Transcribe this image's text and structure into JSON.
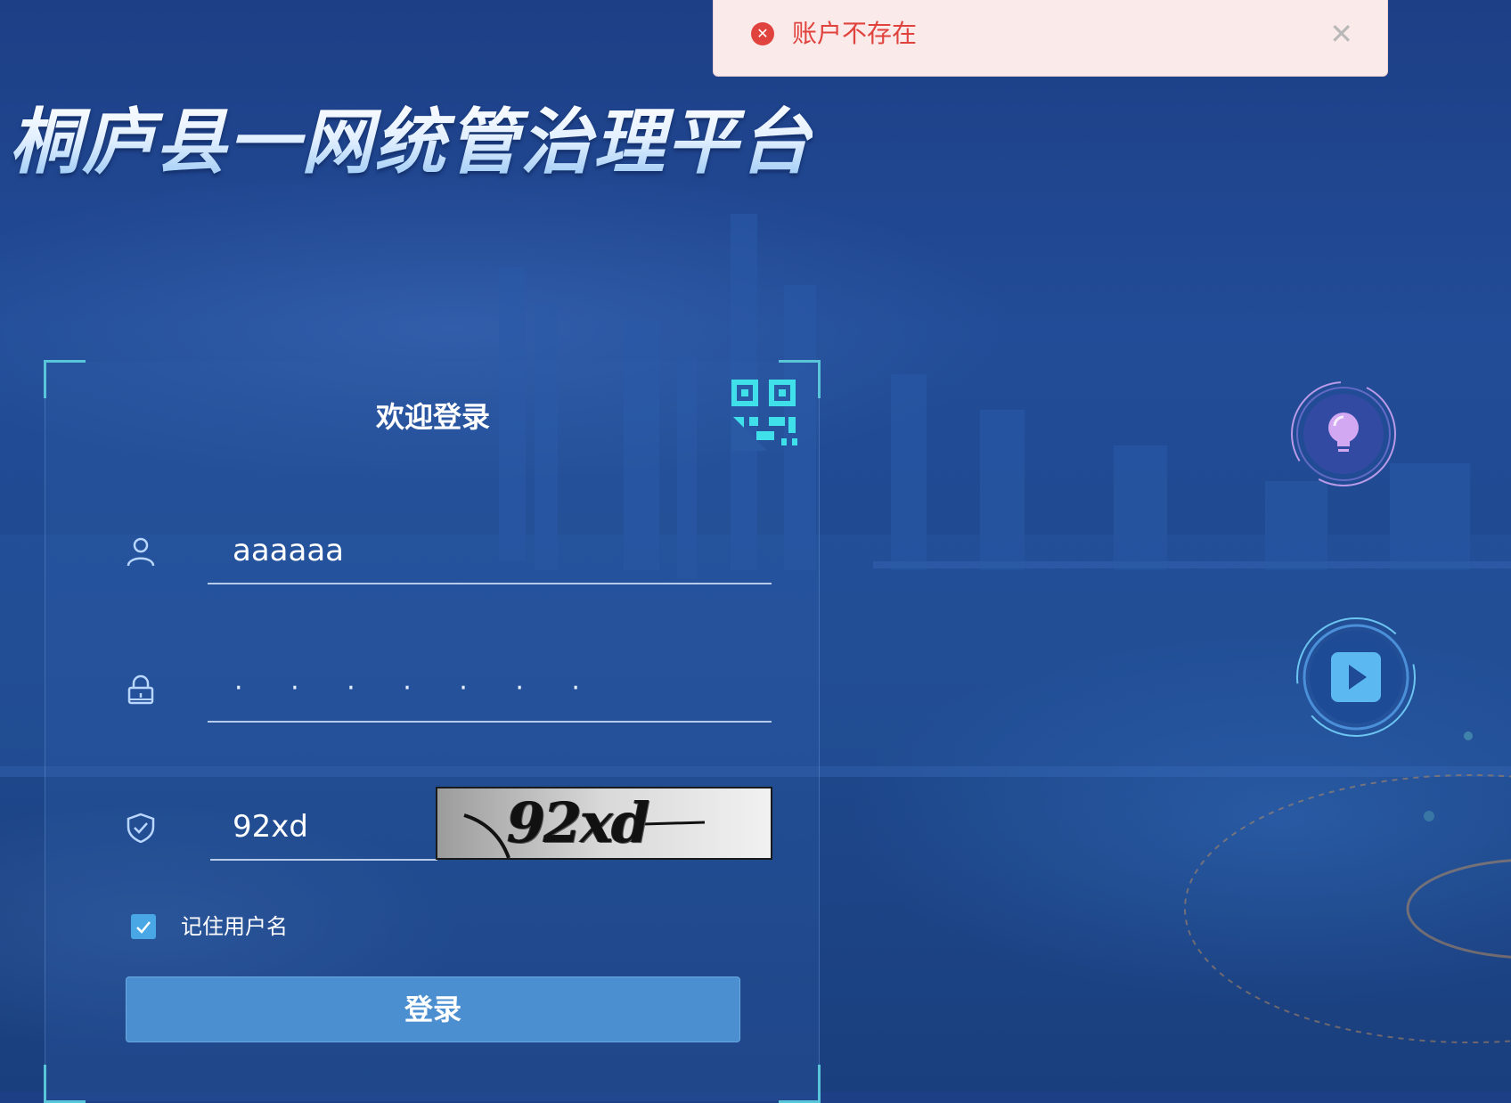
{
  "toast": {
    "type": "error",
    "message": "账户不存在",
    "icon": "error-circle-icon",
    "close_icon": "close-icon",
    "color": "#e0433e"
  },
  "header": {
    "title": "桐庐县一网统管治理平台"
  },
  "login": {
    "title": "欢迎登录",
    "qr_icon": "qr-code-icon",
    "username": {
      "icon": "user-icon",
      "value": "aaaaaa"
    },
    "password": {
      "icon": "lock-icon",
      "masked_value": "· · · · · · ·"
    },
    "captcha": {
      "icon": "shield-icon",
      "value": "92xd",
      "image_text": "92xd"
    },
    "remember": {
      "label": "记住用户名",
      "checked": true
    },
    "submit_label": "登录"
  },
  "side_buttons": [
    {
      "name": "lightbulb-icon"
    },
    {
      "name": "play-icon"
    }
  ],
  "colors": {
    "accent": "#4b8fd0",
    "corner": "#58c6d8",
    "background": "#1f4a8f"
  }
}
